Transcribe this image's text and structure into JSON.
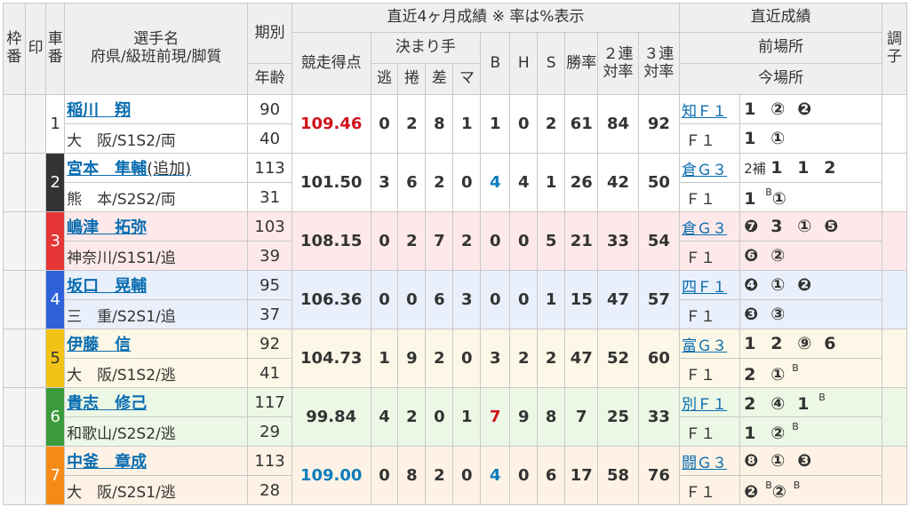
{
  "header": {
    "waku": "枠番",
    "shirushi": "印",
    "sha": "車番",
    "player": "選手名",
    "player_sub": "府県/級班前現/脚質",
    "kibetsu": "期別",
    "nenrei": "年齢",
    "score": "競走得点",
    "recent4": "直近4ヶ月成績 ※ 率は%表示",
    "kimarite": "決まり手",
    "nige": "逃",
    "makuri": "捲",
    "sashi": "差",
    "mark": "マ",
    "b": "B",
    "h": "H",
    "s": "S",
    "win": "勝率",
    "ren2": "２連対率",
    "ren3": "３連対率",
    "recent": "直近成績",
    "prev": "前場所",
    "curr": "今場所",
    "chosi": "調子"
  },
  "colors": {
    "car1": "#ffffff",
    "car2": "#333333",
    "car3": "#e53535",
    "car4": "#2f62d8",
    "car5": "#f2c316",
    "car6": "#3b9a3b",
    "car7": "#f58a17"
  },
  "riders": [
    {
      "car": "1",
      "name": "稲川　翔",
      "pref": "大　阪/S1S2/両",
      "term": "90",
      "age": "40",
      "score": "109.46",
      "score_color": "red",
      "nige": "0",
      "makuri": "2",
      "sashi": "8",
      "mark": "1",
      "b": "1",
      "h": "0",
      "s": "2",
      "win": "61",
      "ren2": "84",
      "ren3": "92",
      "prev_venue": "知Ｆ１",
      "prev_res": [
        "1",
        "②",
        "❷"
      ],
      "curr_venue": "Ｆ１",
      "curr_res": [
        "1",
        "①"
      ]
    },
    {
      "car": "2",
      "name": "宮本　隼輔",
      "name_extra": "(追加)",
      "pref": "熊　本/S2S2/両",
      "term": "113",
      "age": "31",
      "score": "101.50",
      "score_color": "",
      "nige": "3",
      "makuri": "6",
      "sashi": "2",
      "mark": "0",
      "b": "4",
      "b_color": "blue",
      "h": "4",
      "s": "1",
      "win": "26",
      "ren2": "42",
      "ren3": "50",
      "prev_venue": "倉Ｇ３",
      "prev_res": [
        "2補",
        "1",
        "1",
        "2"
      ],
      "curr_venue": "Ｆ１",
      "curr_res": [
        "1B",
        "①"
      ]
    },
    {
      "car": "3",
      "name": "嶋津　拓弥",
      "pref": "神奈川/S1S1/追",
      "term": "103",
      "age": "39",
      "score": "108.15",
      "score_color": "",
      "nige": "0",
      "makuri": "2",
      "sashi": "7",
      "mark": "2",
      "b": "0",
      "h": "0",
      "s": "5",
      "win": "21",
      "ren2": "33",
      "ren3": "54",
      "prev_venue": "倉Ｇ３",
      "prev_res": [
        "❼",
        "3",
        "①",
        "❺"
      ],
      "curr_venue": "Ｆ１",
      "curr_res": [
        "❻",
        "②"
      ]
    },
    {
      "car": "4",
      "name": "坂口　晃輔",
      "pref": "三　重/S2S1/追",
      "term": "95",
      "age": "37",
      "score": "106.36",
      "score_color": "",
      "nige": "0",
      "makuri": "0",
      "sashi": "6",
      "mark": "3",
      "b": "0",
      "h": "0",
      "s": "1",
      "win": "15",
      "ren2": "47",
      "ren3": "57",
      "prev_venue": "四Ｆ１",
      "prev_res": [
        "❹",
        "①",
        "❷"
      ],
      "curr_venue": "Ｆ１",
      "curr_res": [
        "❸",
        "③"
      ]
    },
    {
      "car": "5",
      "name": "伊藤　信",
      "pref": "大　阪/S1S2/逃",
      "term": "92",
      "age": "41",
      "score": "104.73",
      "score_color": "",
      "nige": "1",
      "makuri": "9",
      "sashi": "2",
      "mark": "0",
      "b": "3",
      "h": "2",
      "s": "2",
      "win": "47",
      "ren2": "52",
      "ren3": "60",
      "prev_venue": "富Ｇ３",
      "prev_res": [
        "1",
        "2",
        "⑨",
        "6"
      ],
      "curr_venue": "Ｆ１",
      "curr_res": [
        "2",
        "①B"
      ]
    },
    {
      "car": "6",
      "name": "貴志　修己",
      "pref": "和歌山/S2S2/逃",
      "term": "117",
      "age": "29",
      "score": "99.84",
      "score_color": "",
      "nige": "4",
      "makuri": "2",
      "sashi": "0",
      "mark": "1",
      "b": "7",
      "b_color": "red",
      "h": "9",
      "s": "8",
      "win": "7",
      "ren2": "25",
      "ren3": "33",
      "prev_venue": "別Ｆ１",
      "prev_res": [
        "2",
        "④",
        "1B"
      ],
      "curr_venue": "Ｆ１",
      "curr_res": [
        "1",
        "②B"
      ]
    },
    {
      "car": "7",
      "name": "中釜　章成",
      "pref": "大　阪/S2S1/逃",
      "term": "113",
      "age": "28",
      "score": "109.00",
      "score_color": "blue",
      "nige": "0",
      "makuri": "8",
      "sashi": "2",
      "mark": "0",
      "b": "4",
      "b_color": "blue",
      "h": "0",
      "s": "6",
      "win": "17",
      "ren2": "58",
      "ren3": "76",
      "prev_venue": "闘Ｇ３",
      "prev_res": [
        "❽",
        "①",
        "❸"
      ],
      "curr_venue": "Ｆ１",
      "curr_res": [
        "❷B",
        "②B"
      ]
    }
  ]
}
